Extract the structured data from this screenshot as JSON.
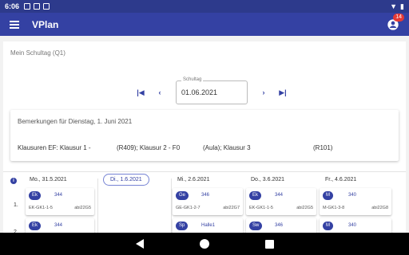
{
  "statusbar": {
    "time": "6:06"
  },
  "appbar": {
    "title": "VPlan",
    "badge": "14"
  },
  "page": {
    "section_title": "Mein Schultag (Q1)",
    "date_label": "Schultag",
    "date_value": "01.06.2021"
  },
  "remarks": {
    "title": "Bemerkungen für Dienstag, 1. Juni 2021",
    "parts": [
      "Klausuren EF: Klausur 1 -",
      "(R409); Klausur 2 - F0",
      "(Aula); Klausur 3",
      "(R101)"
    ]
  },
  "days": [
    {
      "label": "Mo., 31.5.2021"
    },
    {
      "label": "Di., 1.6.2021"
    },
    {
      "label": "Mi., 2.6.2021"
    },
    {
      "label": "Do., 3.6.2021"
    },
    {
      "label": "Fr., 4.6.2021"
    }
  ],
  "rows": [
    "1.",
    "2."
  ],
  "lessons": [
    {
      "subject": "Ek",
      "room": "344",
      "course": "EK-GK1-1-5",
      "teacher": "abi22G5"
    },
    {
      "subject": "Ge",
      "room": "346",
      "course": "GE-GK1-2-7",
      "teacher": "abi22G7"
    },
    {
      "subject": "Ek",
      "room": "344",
      "course": "EK-GK1-1-5",
      "teacher": "abi22G5"
    },
    {
      "subject": "M",
      "room": "340",
      "course": "M-GK1-3-8",
      "teacher": "abi22G8"
    },
    {
      "subject": "Ek",
      "room": "344",
      "course": "",
      "teacher": ""
    },
    {
      "subject": "Sp",
      "room": "Halle1",
      "course": "",
      "teacher": ""
    },
    {
      "subject": "Sw",
      "room": "346",
      "course": "",
      "teacher": ""
    },
    {
      "subject": "M",
      "room": "340",
      "course": "",
      "teacher": ""
    }
  ]
}
